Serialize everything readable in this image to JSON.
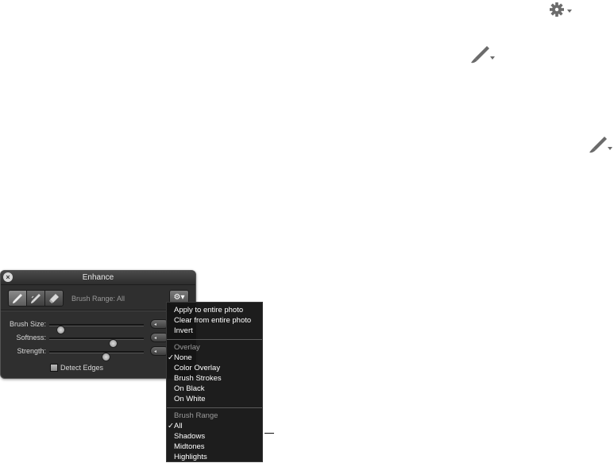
{
  "window": {
    "title": "Enhance"
  },
  "toolbar": {
    "tools": [
      "brush-tool",
      "feather-tool",
      "eraser-tool"
    ],
    "brush_range_label": "Brush Range: All",
    "gear_label": "⚙▾"
  },
  "sliders": [
    {
      "label": "Brush Size:",
      "value": 0.12
    },
    {
      "label": "Softness:",
      "value": 0.67
    },
    {
      "label": "Strength:",
      "value": 0.6
    }
  ],
  "detect_edges": {
    "label": "Detect Edges",
    "checked": false
  },
  "menu": {
    "actions": [
      "Apply to entire photo",
      "Clear from entire photo",
      "Invert"
    ],
    "overlay": {
      "header": "Overlay",
      "items": [
        "None",
        "Color Overlay",
        "Brush Strokes",
        "On Black",
        "On White"
      ],
      "selected": "None"
    },
    "brush_range": {
      "header": "Brush Range",
      "items": [
        "All",
        "Shadows",
        "Midtones",
        "Highlights"
      ],
      "selected": "All"
    }
  },
  "checkmark": "✓",
  "icons": {
    "floating": [
      "gear-menu-icon",
      "brush-menu-icon",
      "brush-menu-icon"
    ]
  }
}
